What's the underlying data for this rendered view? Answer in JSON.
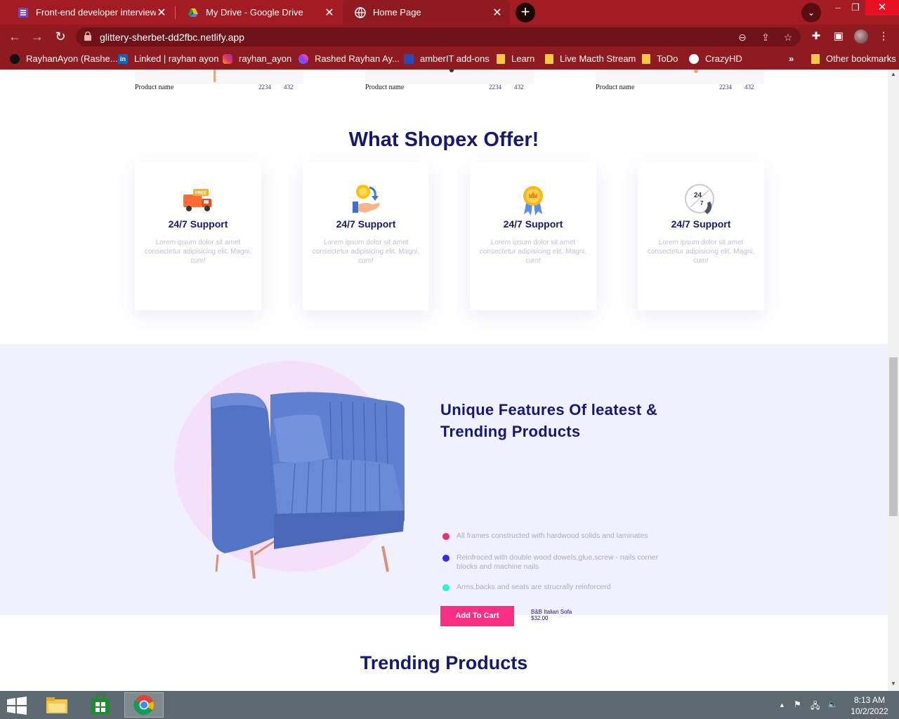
{
  "browser": {
    "tabs": [
      {
        "title": "Front-end developer interview as",
        "active": false
      },
      {
        "title": "My Drive - Google Drive",
        "active": false
      },
      {
        "title": "Home Page",
        "active": true
      }
    ],
    "url": "glittery-sherbet-dd2fbc.netlify.app",
    "bookmarks": [
      {
        "label": "RayhanAyon (Rashe...",
        "icon": "github-icon"
      },
      {
        "label": "Linked | rayhan ayon",
        "icon": "linkedin-icon"
      },
      {
        "label": "rayhan_ayon",
        "icon": "instagram-icon"
      },
      {
        "label": "Rashed Rayhan Ay...",
        "icon": "messenger-icon"
      },
      {
        "label": "amberIT add-ons",
        "icon": "amberit-icon"
      },
      {
        "label": "Learn",
        "icon": "folder-icon"
      },
      {
        "label": "Live Macth Stream",
        "icon": "folder-icon"
      },
      {
        "label": "ToDo",
        "icon": "folder-icon"
      },
      {
        "label": "CrazyHD",
        "icon": "globe-icon"
      }
    ],
    "overflow_label": "»",
    "other_bookmarks": "Other bookmarks"
  },
  "products": [
    {
      "name": "Product name",
      "v1": "2234",
      "v2": "432"
    },
    {
      "name": "Product name",
      "v1": "2234",
      "v2": "432"
    },
    {
      "name": "Product name",
      "v1": "2234",
      "v2": "432"
    }
  ],
  "offer": {
    "title": "What Shopex Offer!",
    "cards": [
      {
        "icon": "free-delivery-truck-icon",
        "title": "24/7 Support",
        "desc": "Lorem ipsum dolor sit amet consectetur adipisicing elit. Magni, cum!"
      },
      {
        "icon": "cashback-hand-icon",
        "title": "24/7 Support",
        "desc": "Lorem ipsum dolor sit amet consectetur adipisicing elit. Magni, cum!"
      },
      {
        "icon": "quality-badge-icon",
        "title": "24/7 Support",
        "desc": "Lorem ipsum dolor sit amet consectetur adipisicing elit. Magni, cum!"
      },
      {
        "icon": "support-24-7-icon",
        "title": "24/7 Support",
        "desc": "Lorem ipsum dolor sit amet consectetur adipisicing elit. Magni, cum!"
      }
    ]
  },
  "feature": {
    "title": "Unique Features Of leatest & Trending Products",
    "items": [
      {
        "text": "All frames constructed with hardwood solids and laminates",
        "color": "#f52b70"
      },
      {
        "text": "Reinfroced with double wood dowels,glue,screw - nails corner blocks and machine nails",
        "color": "#2b2bf5"
      },
      {
        "text": "Arms,backs and seats are strucrally reinforcerd",
        "color": "#2bf5cc"
      }
    ],
    "cart_label": "Add To Cart",
    "product_name": "B&B Italian Sofa",
    "product_price": "$32.00"
  },
  "trending": {
    "title": "Trending Products"
  },
  "taskbar": {
    "time": "8:13 AM",
    "date": "10/2/2022"
  },
  "colors": {
    "navy": "#151875",
    "pink": "#fb2e86",
    "chrome": "#a31c24",
    "feature_bg": "#f1f0ff"
  }
}
